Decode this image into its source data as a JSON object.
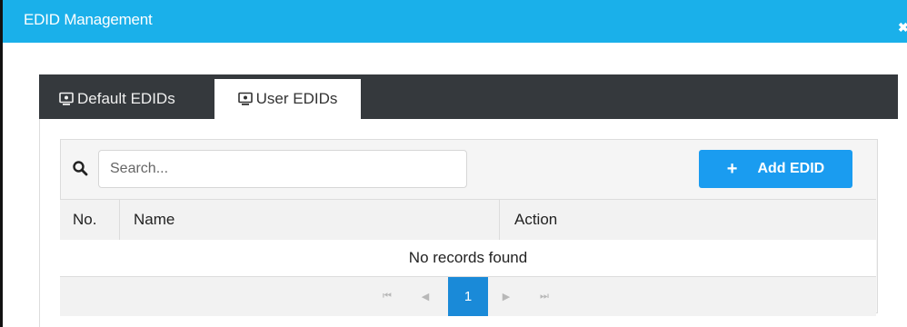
{
  "dialog": {
    "title": "EDID Management",
    "close_glyph": "✖"
  },
  "tabs": [
    {
      "label": "Default EDIDs",
      "icon": "monitor-icon",
      "active": false
    },
    {
      "label": "User EDIDs",
      "icon": "monitor-icon",
      "active": true
    }
  ],
  "toolbar": {
    "search_placeholder": "Search...",
    "search_value": "",
    "add_label": "Add EDID",
    "add_icon": "plus-icon"
  },
  "table": {
    "columns": [
      "No.",
      "Name",
      "Action"
    ],
    "empty_message": "No records found"
  },
  "pagination": {
    "current_page": "1",
    "first_glyph": "⏮",
    "prev_glyph": "◀",
    "next_glyph": "▶",
    "last_glyph": "⏭"
  },
  "colors": {
    "titlebar": "#1ab0ea",
    "tabbar": "#35393d",
    "primary_button": "#1a9cf0",
    "active_page": "#1a8ad8"
  }
}
